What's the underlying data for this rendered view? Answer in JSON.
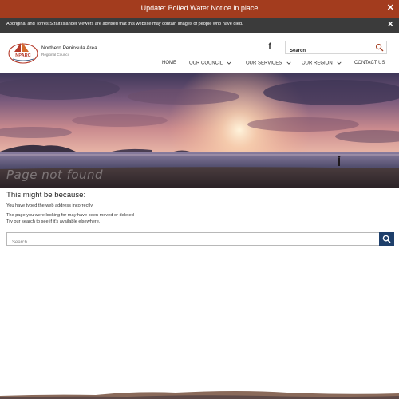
{
  "alert": {
    "text": "Update: Boiled Water Notice in place",
    "close": "✕"
  },
  "notice": {
    "text": "Aboriginal and Torres Strait Islander viewers are advised that this website may contain images of people who have died.",
    "close": "✕"
  },
  "header": {
    "logo_text": "NPARC",
    "org_name": "Northern Peninsula Area",
    "org_sub": "Regional Council",
    "social_icon": "facebook-icon",
    "search_placeholder": "Search",
    "nav": [
      {
        "label": "HOME",
        "has_dropdown": false
      },
      {
        "label": "OUR COUNCIL",
        "has_dropdown": true
      },
      {
        "label": "OUR SERVICES",
        "has_dropdown": true
      },
      {
        "label": "OUR REGION",
        "has_dropdown": true
      },
      {
        "label": "CONTACT US",
        "has_dropdown": false
      }
    ]
  },
  "hero": {
    "title": "Page not found"
  },
  "content": {
    "heading": "This might be because:",
    "reason_1": "You have typed the web address incorrectly",
    "reason_2": "The page you were looking for may have been moved or deleted",
    "reason_3": "Try our search to see if it's available elsewhere.",
    "search_placeholder": "Search"
  },
  "colors": {
    "alert_bar": "#a33c1e",
    "notice_bar": "#3b3b3b",
    "search_button": "#1e3f6b"
  }
}
